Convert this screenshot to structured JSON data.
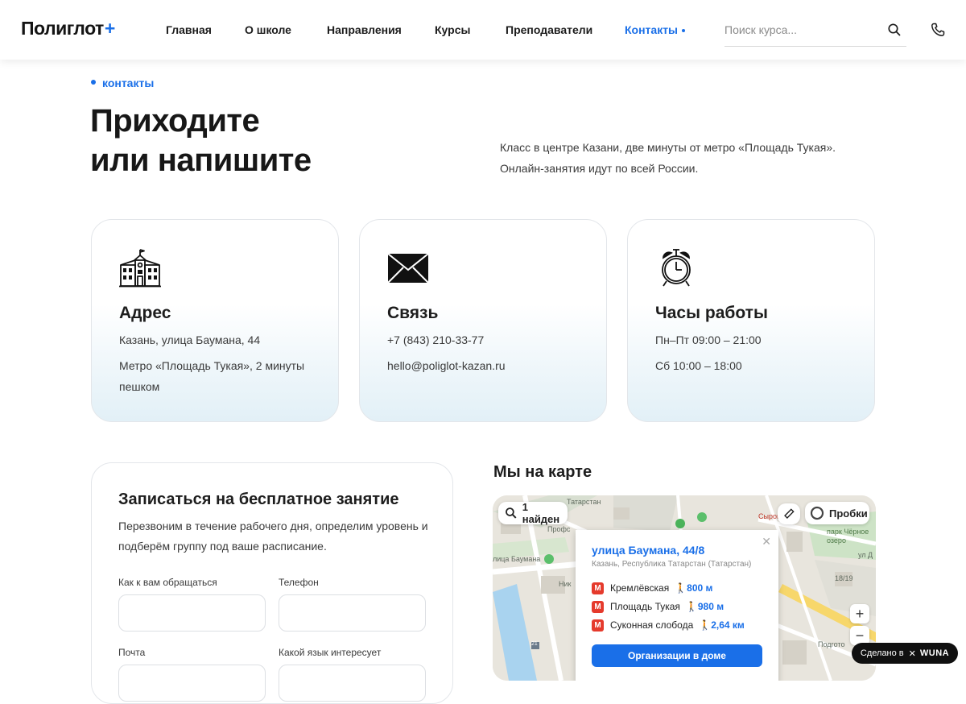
{
  "brand": {
    "name": "Полиглот",
    "plus": "+"
  },
  "nav": {
    "items": [
      "Главная",
      "О школе",
      "Направления",
      "Курсы",
      "Преподаватели",
      "Контакты"
    ],
    "active": "Контакты"
  },
  "search": {
    "placeholder": "Поиск курса..."
  },
  "hero": {
    "kicker": "контакты",
    "title_line1": "Приходите",
    "title_line2": "или напишите",
    "description": "Класс в центре Казани, две минуты от метро «Площадь Тукая». Онлайн-занятия идут по всей России."
  },
  "cards": [
    {
      "title": "Адрес",
      "icon": "school-building-icon",
      "lines": [
        "Казань, улица Баумана, 44",
        "Метро «Площадь Тукая», 2 минуты пешком"
      ]
    },
    {
      "title": "Связь",
      "icon": "envelope-icon",
      "lines": [
        "+7 (843) 210-33-77",
        "hello@poliglot-kazan.ru"
      ]
    },
    {
      "title": "Часы работы",
      "icon": "alarm-clock-icon",
      "lines": [
        "Пн–Пт 09:00 – 21:00",
        "Сб 10:00 – 18:00"
      ]
    }
  ],
  "form": {
    "title": "Записаться на бесплатное занятие",
    "description": "Перезвоним в течение рабочего дня, определим уровень и подберём группу под ваше расписание.",
    "fields": {
      "name_label": "Как к вам обращаться",
      "phone_label": "Телефон",
      "email_label": "Почта",
      "language_label": "Какой язык интересует"
    }
  },
  "map": {
    "title": "Мы на карте",
    "search_result": "1 найден",
    "traffic_label": "Пробки",
    "popup": {
      "title": "улица Баумана, 44/8",
      "address": "Казань, Республика Татарстан (Татарстан)",
      "metro": [
        {
          "name": "Кремлёвская",
          "distance": "800 м"
        },
        {
          "name": "Площадь Тукая",
          "distance": "980 м"
        },
        {
          "name": "Суконная слобода",
          "distance": "2,64 км"
        }
      ],
      "button": "Организации в доме",
      "metro_letter": "М"
    },
    "labels": {
      "tatarstan": "Татарстан",
      "bauman": "лица Баумана",
      "syrop": "Сыров",
      "park": "парк Чёрное озеро",
      "ulD": "ул Д",
      "profs": "Профс",
      "nik": "Ник",
      "podgoto": "Подгото",
      "num1": "21",
      "num2": "18/19"
    },
    "zoom_in": "+",
    "zoom_out": "−"
  },
  "made_by": {
    "prefix": "Сделано в",
    "brand": "WUNA"
  },
  "colors": {
    "accent": "#1a6fe8",
    "metro_red": "#e53a2c",
    "text": "#1c1c1c"
  }
}
